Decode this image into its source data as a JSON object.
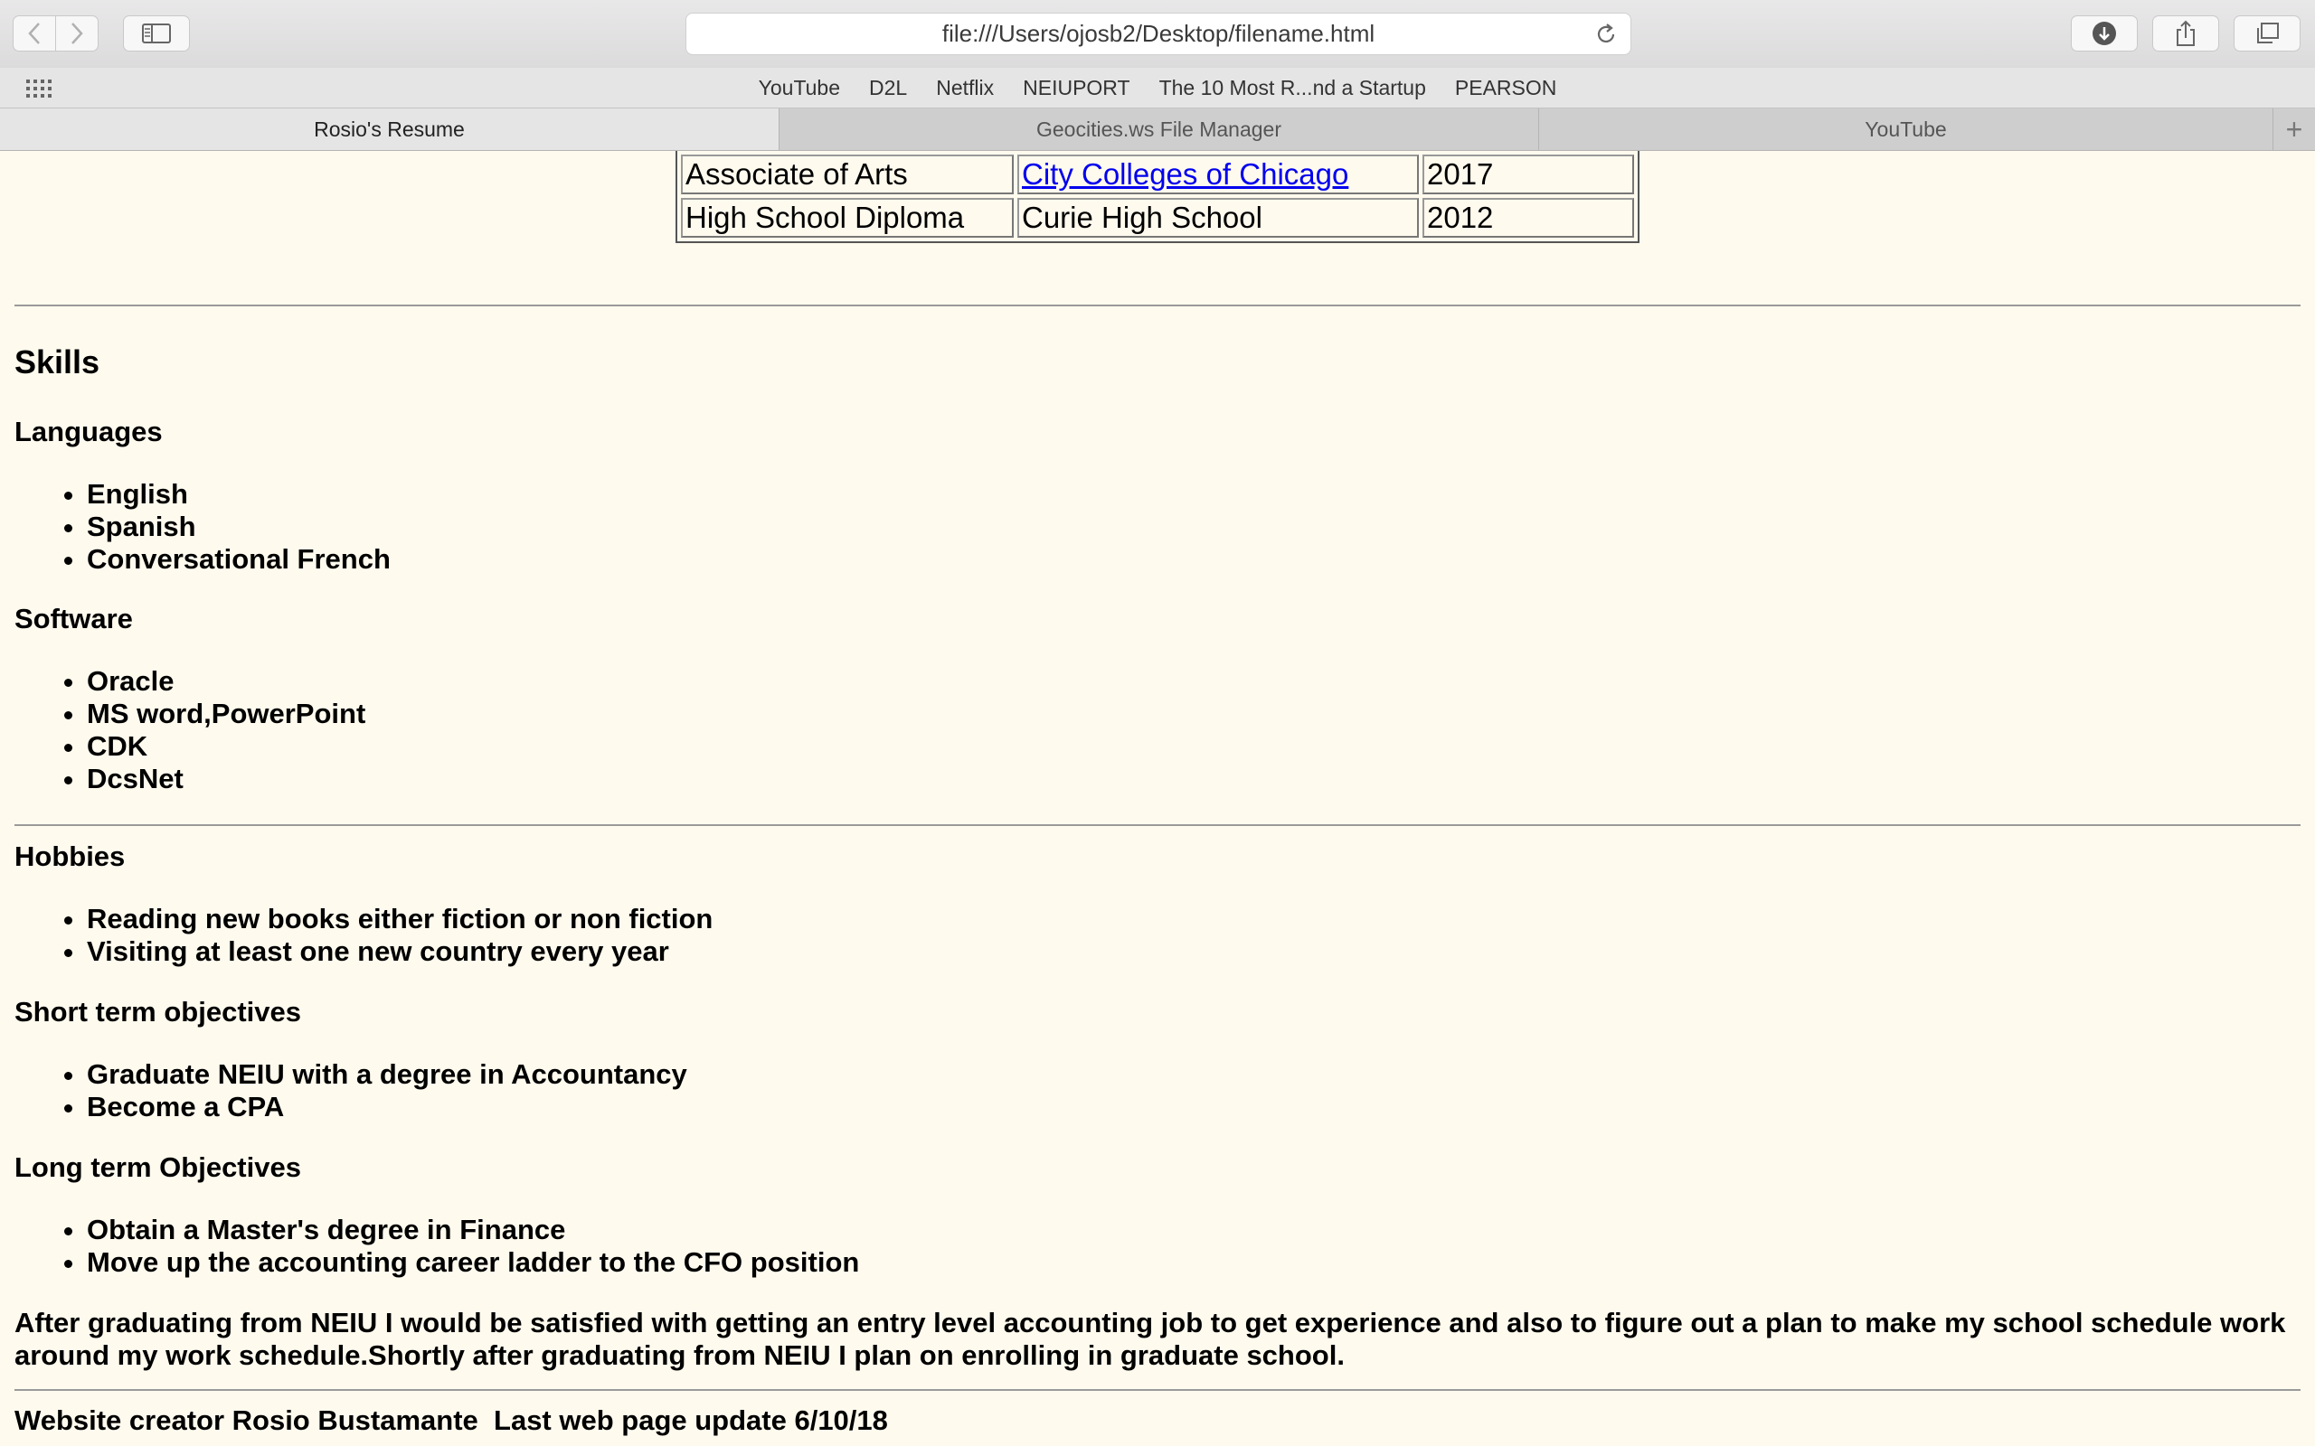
{
  "browser": {
    "url": "file:///Users/ojosb2/Desktop/filename.html",
    "bookmarks": [
      "YouTube",
      "D2L",
      "Netflix",
      "NEIUPORT",
      "The 10 Most R...nd a Startup",
      "PEARSON"
    ],
    "tabs": [
      {
        "label": "Rosio's Resume",
        "active": true
      },
      {
        "label": "Geocities.ws File Manager",
        "active": false
      },
      {
        "label": "YouTube",
        "active": false
      }
    ],
    "new_tab_symbol": "+",
    "icons": [
      "back-icon",
      "forward-icon",
      "sidebar-icon",
      "reload-icon",
      "download-icon",
      "share-icon",
      "tabs-overview-icon",
      "grid-icon"
    ]
  },
  "education": {
    "rows": [
      {
        "degree": "Associate of Arts",
        "school": "City Colleges of Chicago",
        "year": "2017"
      },
      {
        "degree": "High School Diploma",
        "school": "Curie High School",
        "year": "2012"
      }
    ]
  },
  "skills": {
    "title": "Skills",
    "languages_title": "Languages",
    "languages": [
      "English",
      "Spanish",
      "Conversational French"
    ],
    "software_title": "Software",
    "software": [
      "Oracle",
      "MS word,PowerPoint",
      "CDK",
      "DcsNet"
    ]
  },
  "hobbies": {
    "title": "Hobbies",
    "items": [
      "Reading new books either fiction or non fiction",
      "Visiting at least one new country every year"
    ]
  },
  "short_term": {
    "title": "Short term objectives",
    "items": [
      "Graduate NEIU with a degree in Accountancy",
      "Become a CPA"
    ]
  },
  "long_term": {
    "title": "Long term Objectives",
    "items": [
      "Obtain a Master's degree in Finance",
      "Move up the accounting career ladder to the CFO position"
    ]
  },
  "plan_paragraph": "After graduating from NEIU I would be satisfied with getting an entry level accounting job to get experience and also to figure out a plan to make my school schedule work around my work schedule.Shortly after graduating from NEIU I plan on enrolling in graduate school.",
  "footer": "Website creator Rosio Bustamante  Last web page update 6/10/18"
}
